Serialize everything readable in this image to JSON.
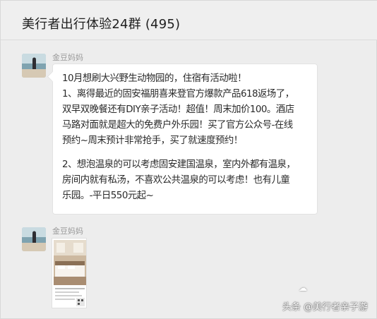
{
  "header": {
    "title": "美行者出行体验24群 (495)"
  },
  "messages": [
    {
      "sender": "金豆妈妈",
      "lines": [
        "10月想刷大兴野生动物园的，住宿有活动啦！",
        "1、离得最近的固安福朋喜来登官方爆款产品618返场了，",
        "双早双晚餐还有DIY亲子活动！超值！周末加价100。酒店",
        "马路对面就是超大的免费户外乐园！买了官方公众号-在线",
        "预约~周末预计非常抢手，买了就速度预约！",
        "",
        "2、想泡温泉的可以考虑固安建国温泉，室内外都有温泉，",
        "房间内就有私汤，不喜欢公共温泉的可以考虑！也有儿童",
        "乐园。-平日550元起~"
      ]
    },
    {
      "sender": "金豆妈妈"
    }
  ],
  "watermark": {
    "text": "头条 @美行者亲子游"
  },
  "icons": {
    "avatar": "user-avatar-icon",
    "hotel_room": "hotel-room-image-icon",
    "logo": "watermark-logo-icon"
  }
}
